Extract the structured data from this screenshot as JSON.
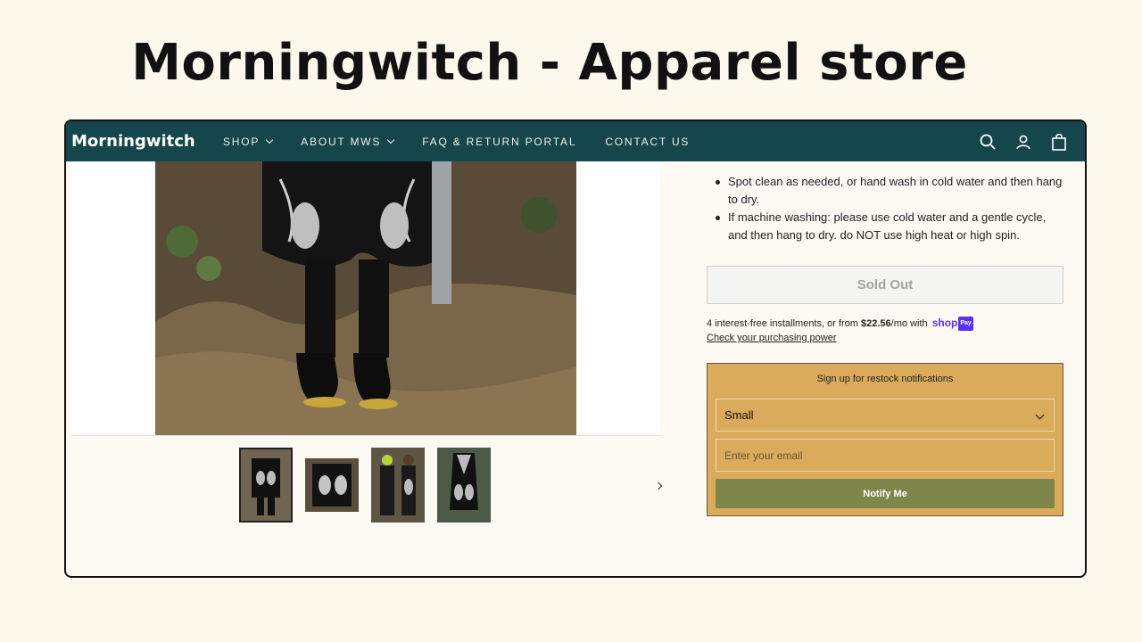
{
  "slide": {
    "title": "Morningwitch - Apparel store"
  },
  "nav": {
    "brand": "Morningwitch",
    "items": [
      {
        "label": "SHOP",
        "has_dropdown": true
      },
      {
        "label": "ABOUT MWS",
        "has_dropdown": true
      },
      {
        "label": "FAQ & RETURN PORTAL",
        "has_dropdown": false
      },
      {
        "label": "CONTACT US",
        "has_dropdown": false
      }
    ],
    "icons": [
      "search-icon",
      "account-icon",
      "cart-icon"
    ]
  },
  "care": {
    "items": [
      "Spot clean as needed, or hand wash in cold water and then hang to dry.",
      "If machine washing: please use cold water and a gentle cycle, and then hang to dry. do NOT use high heat or high spin."
    ]
  },
  "purchase": {
    "sold_out_label": "Sold Out",
    "installments_prefix": "4 interest-free installments, or from ",
    "installments_amount": "$22.56",
    "installments_suffix": "/mo with",
    "shoppay_label": "shop",
    "shoppay_badge": "Pay",
    "check_power_link": "Check your purchasing power"
  },
  "restock": {
    "title": "Sign up for restock notifications",
    "selected_size": "Small",
    "email_placeholder": "Enter your email",
    "notify_label": "Notify Me"
  },
  "colors": {
    "nav_bg": "#14464b",
    "restock_bg": "#d9ab5a",
    "notify_btn": "#7e864c",
    "page_bg": "#fcf9ec"
  }
}
